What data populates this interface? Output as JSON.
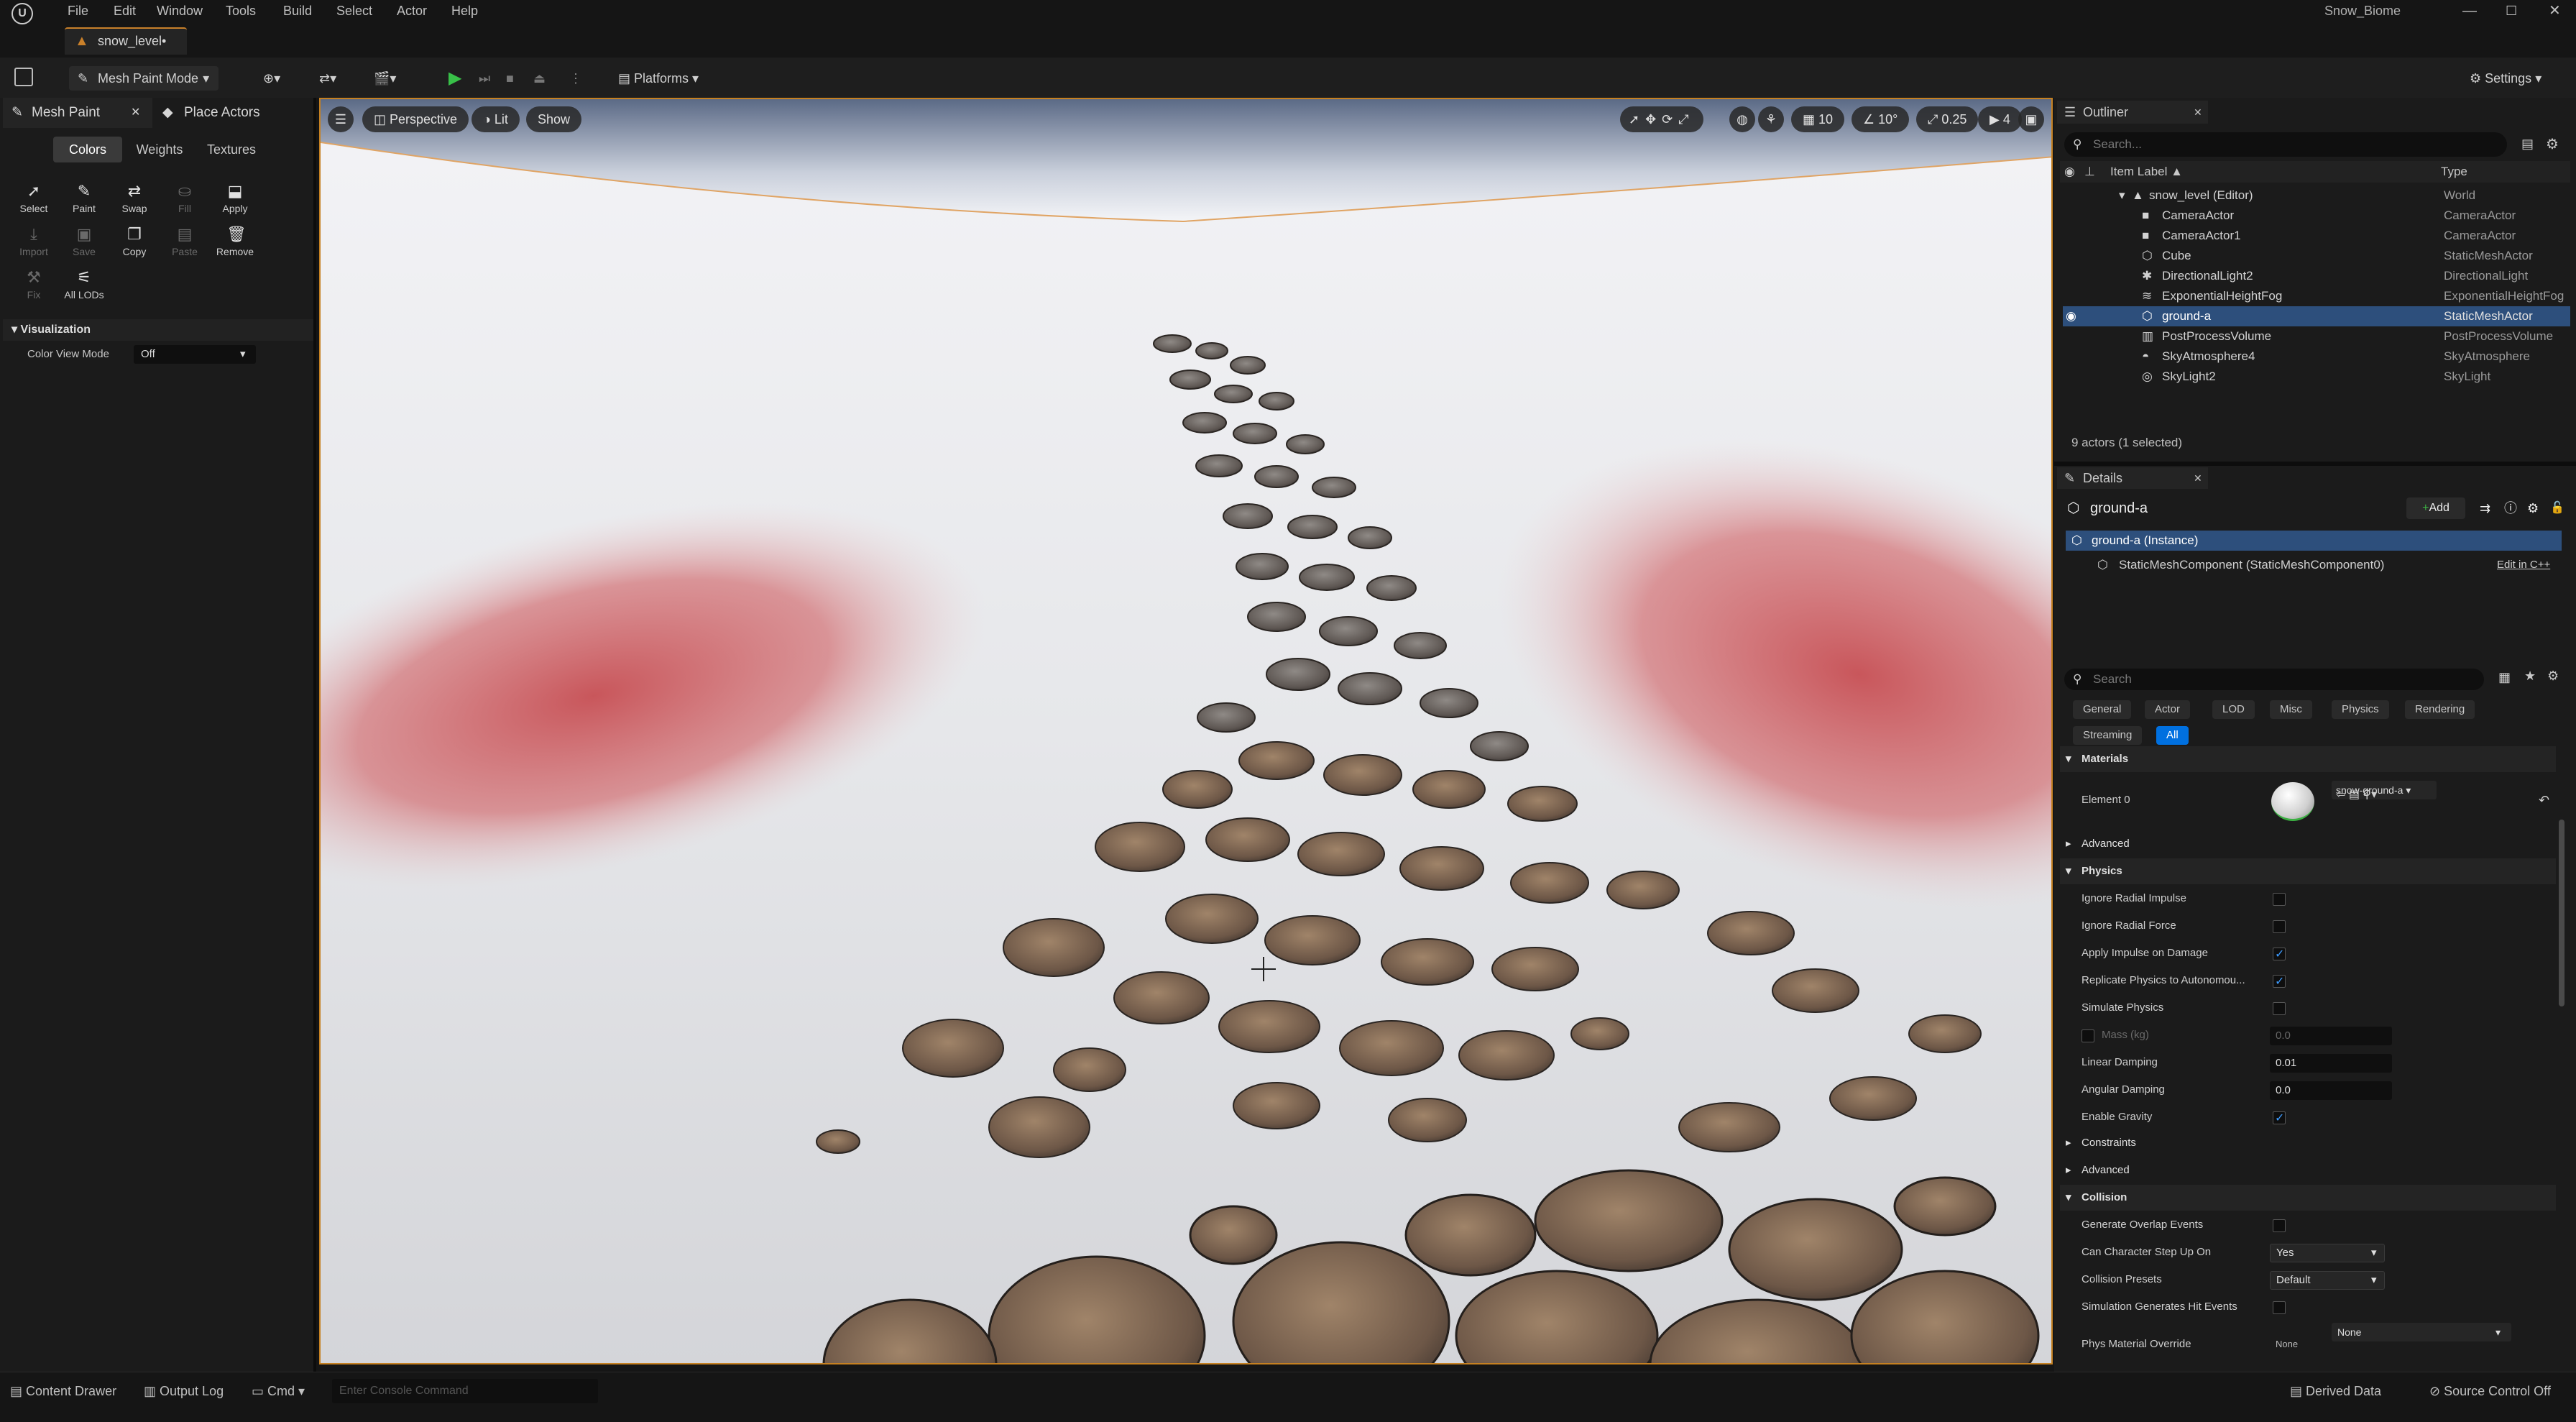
{
  "window": {
    "project_name": "Snow_Biome",
    "doc_tab": "snow_level•"
  },
  "menu": [
    "File",
    "Edit",
    "Window",
    "Tools",
    "Build",
    "Select",
    "Actor",
    "Help"
  ],
  "toolbar": {
    "mode": "Mesh Paint Mode",
    "platforms": "Platforms",
    "settings": "Settings"
  },
  "left_panel": {
    "tabs": [
      "Mesh Paint",
      "Place Actors"
    ],
    "paint_modes": [
      "Colors",
      "Weights",
      "Textures"
    ],
    "tools_row1": [
      "Select",
      "Paint",
      "Swap",
      "Fill",
      "Apply"
    ],
    "tools_row2": [
      "Import",
      "Save",
      "Copy",
      "Paste",
      "Remove"
    ],
    "tools_row3": [
      "Fix",
      "All LODs"
    ],
    "visualization": {
      "header": "Visualization",
      "label": "Color View Mode",
      "value": "Off"
    }
  },
  "viewport": {
    "perspective": "Perspective",
    "lit": "Lit",
    "show": "Show",
    "grid_snap": "10",
    "rot_snap": "10°",
    "scale_snap": "0.25",
    "camera_speed": "4"
  },
  "outliner": {
    "title": "Outliner",
    "search_placeholder": "Search...",
    "col_label": "Item Label ▲",
    "col_type": "Type",
    "rows": [
      {
        "label": "snow_level (Editor)",
        "type": "World"
      },
      {
        "label": "CameraActor",
        "type": "CameraActor"
      },
      {
        "label": "CameraActor1",
        "type": "CameraActor"
      },
      {
        "label": "Cube",
        "type": "StaticMeshActor"
      },
      {
        "label": "DirectionalLight2",
        "type": "DirectionalLight"
      },
      {
        "label": "ExponentialHeightFog",
        "type": "ExponentialHeightFog"
      },
      {
        "label": "ground-a",
        "type": "StaticMeshActor"
      },
      {
        "label": "PostProcessVolume",
        "type": "PostProcessVolume"
      },
      {
        "label": "SkyAtmosphere4",
        "type": "SkyAtmosphere"
      },
      {
        "label": "SkyLight2",
        "type": "SkyLight"
      }
    ],
    "summary": "9 actors (1 selected)"
  },
  "details": {
    "title": "Details",
    "actor_name": "ground-a",
    "add_label": "Add",
    "instance": "ground-a (Instance)",
    "component": "StaticMeshComponent (StaticMeshComponent0)",
    "edit_cpp": "Edit in C++",
    "search_placeholder": "Search",
    "categories_row1": [
      "General",
      "Actor",
      "LOD",
      "Misc",
      "Physics",
      "Rendering"
    ],
    "categories_row2": [
      "Streaming",
      "All"
    ],
    "materials_header": "Materials",
    "element0_label": "Element 0",
    "element0_value": "snow-ground-a",
    "advanced1": "Advanced",
    "physics_header": "Physics",
    "physics": {
      "ignore_radial_impulse": "Ignore Radial Impulse",
      "ignore_radial_force": "Ignore Radial Force",
      "apply_impulse": "Apply Impulse on Damage",
      "replicate_physics": "Replicate Physics to Autonomou...",
      "simulate_physics": "Simulate Physics",
      "mass_label": "Mass (kg)",
      "mass_value": "0.0",
      "linear_damping_label": "Linear Damping",
      "linear_damping_value": "0.01",
      "angular_damping_label": "Angular Damping",
      "angular_damping_value": "0.0",
      "enable_gravity": "Enable Gravity"
    },
    "constraints": "Constraints",
    "advanced2": "Advanced",
    "collision_header": "Collision",
    "collision": {
      "overlap_label": "Generate Overlap Events",
      "step_up_label": "Can Character Step Up On",
      "step_up_value": "Yes",
      "presets_label": "Collision Presets",
      "presets_value": "Default",
      "hit_events_label": "Simulation Generates Hit Events",
      "phys_material_label": "Phys Material Override",
      "phys_material_value": "None",
      "phys_material_none": "None"
    }
  },
  "statusbar": {
    "content_drawer": "Content Drawer",
    "output_log": "Output Log",
    "cmd": "Cmd",
    "console_placeholder": "Enter Console Command",
    "derived_data": "Derived Data",
    "source_control": "Source Control Off"
  },
  "colors": {
    "accent": "#c58021",
    "selection": "#2d4f7c",
    "blue": "#0070e0",
    "paint_red": "#c5464b"
  }
}
